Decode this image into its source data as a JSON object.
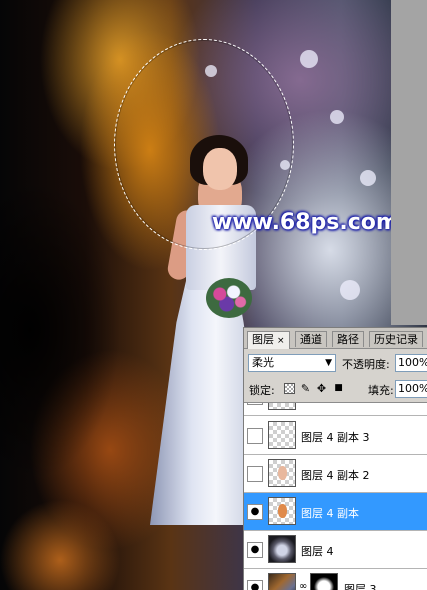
{
  "watermark": {
    "text": "www.68ps.com"
  },
  "panel": {
    "tabs": [
      {
        "label": "图层",
        "close": "×",
        "active": true
      },
      {
        "label": "通道",
        "active": false
      },
      {
        "label": "路径",
        "active": false
      },
      {
        "label": "历史记录",
        "active": false
      }
    ],
    "blend_mode": "柔光",
    "opacity_label": "不透明度:",
    "opacity_value": "100%",
    "lock_label": "锁定:",
    "lock_icons": [
      "transparency-lock-icon",
      "brush-lock-icon",
      "move-lock-icon",
      "padlock-icon"
    ],
    "fill_label": "填充:",
    "fill_value": "100%",
    "layers": [
      {
        "name": "",
        "visible": false,
        "selected": false,
        "thumb": "transparent"
      },
      {
        "name": "图层 4 副本 3",
        "visible": false,
        "selected": false,
        "thumb": "transparent"
      },
      {
        "name": "图层 4 副本 2",
        "visible": false,
        "selected": false,
        "thumb": "transparent-skin"
      },
      {
        "name": "图层 4 副本",
        "visible": true,
        "selected": true,
        "thumb": "transparent-orange"
      },
      {
        "name": "图层 4",
        "visible": true,
        "selected": false,
        "thumb": "dark-glow"
      },
      {
        "name": "图层 3",
        "visible": true,
        "selected": false,
        "thumb": "photo-with-mask"
      }
    ]
  },
  "colors": {
    "selection_highlight": "#3399ff",
    "watermark_glow": "#1b1fa8",
    "panel_bg": "#d6d3ce"
  }
}
